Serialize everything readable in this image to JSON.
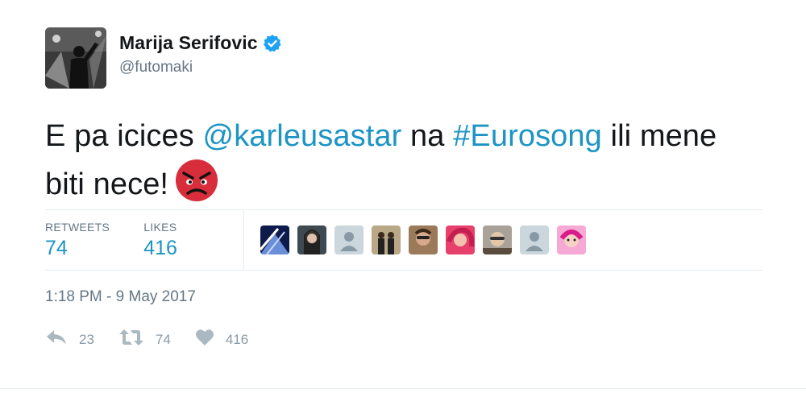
{
  "author": {
    "name": "Marija Serifovic",
    "handle": "@futomaki",
    "verified": true
  },
  "tweet": {
    "text_part1": "E pa icices ",
    "mention": "@karleusastar",
    "text_part2": " na ",
    "hashtag": "#Eurosong",
    "text_part3": " ili mene biti nece!",
    "emoji": "angry-face"
  },
  "stats": {
    "retweets_label": "RETWEETS",
    "retweets_value": "74",
    "likes_label": "LIKES",
    "likes_value": "416"
  },
  "likers_count_shown": 9,
  "timestamp": "1:18 PM - 9 May 2017",
  "actions": {
    "reply_count": "23",
    "retweet_count": "74",
    "like_count": "416"
  },
  "colors": {
    "link": "#1c94c4",
    "muted": "#657786",
    "verified": "#1da1f2",
    "emoji": "#d82d3b"
  }
}
